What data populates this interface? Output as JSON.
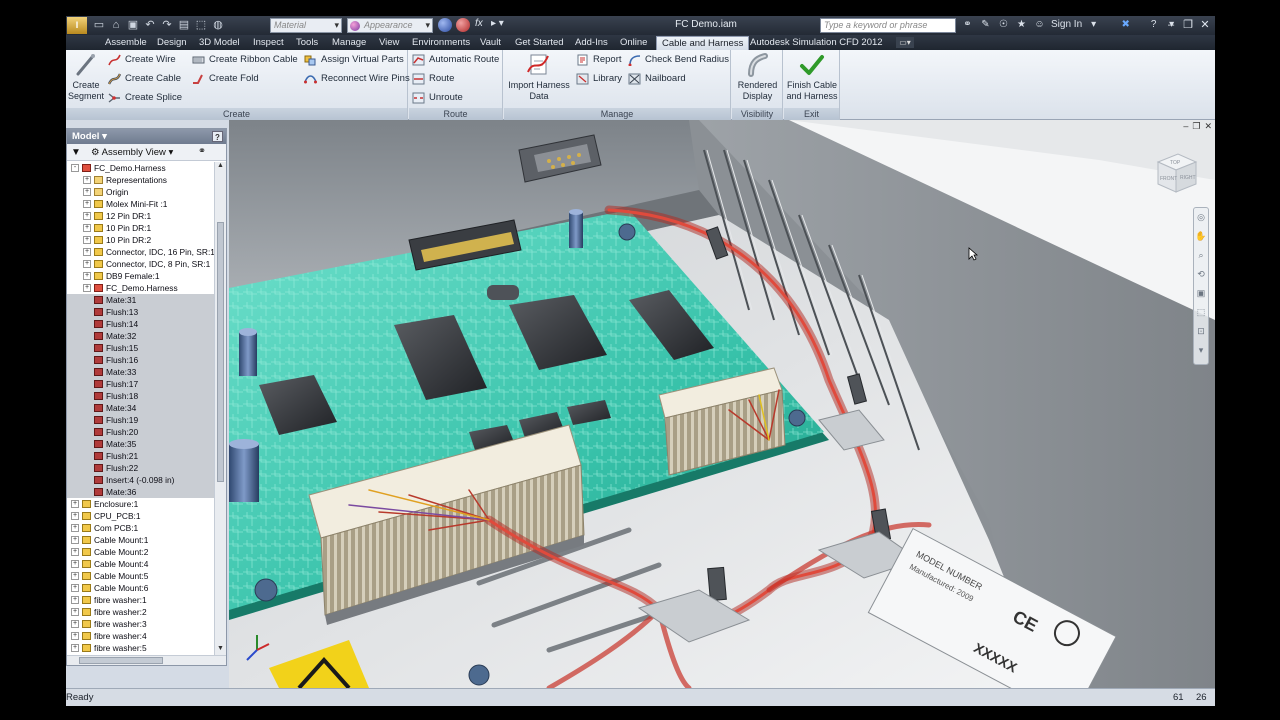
{
  "app": {
    "logo_text": "I",
    "document_title": "FC Demo.iam",
    "material_placeholder": "Material",
    "appearance_placeholder": "Appearance",
    "search_placeholder": "Type a keyword or phrase",
    "sign_in": "Sign In",
    "fx_label": "fx"
  },
  "tabs": [
    {
      "label": "Assemble"
    },
    {
      "label": "Design"
    },
    {
      "label": "3D Model"
    },
    {
      "label": "Inspect"
    },
    {
      "label": "Tools"
    },
    {
      "label": "Manage"
    },
    {
      "label": "View"
    },
    {
      "label": "Environments"
    },
    {
      "label": "Vault"
    },
    {
      "label": "Get Started"
    },
    {
      "label": "Add-Ins"
    },
    {
      "label": "Online"
    },
    {
      "label": "Cable and Harness",
      "active": true
    },
    {
      "label": "Autodesk Simulation CFD 2012"
    }
  ],
  "ribbon": {
    "create": {
      "label": "Create",
      "create_segment": "Create Segment",
      "create_wire": "Create Wire",
      "create_cable": "Create Cable",
      "create_splice": "Create Splice",
      "create_ribbon_cable": "Create Ribbon Cable",
      "create_fold": "Create Fold",
      "assign_virtual_parts": "Assign Virtual Parts",
      "reconnect_wire_pins": "Reconnect Wire Pins"
    },
    "route": {
      "label": "Route",
      "automatic_route": "Automatic Route",
      "route": "Route",
      "unroute": "Unroute"
    },
    "manage": {
      "label": "Manage",
      "import_harness_data": "Import Harness Data",
      "report": "Report",
      "library": "Library",
      "check_bend_radius": "Check Bend Radius",
      "nailboard": "Nailboard"
    },
    "visibility": {
      "label": "Visibility",
      "rendered_display": "Rendered Display"
    },
    "exit": {
      "label": "Exit",
      "finish": "Finish Cable and Harness"
    }
  },
  "browser": {
    "title": "Model",
    "help": "?",
    "view_label": "Assembly View",
    "tree": [
      {
        "label": "FC_Demo.Harness",
        "level": 0,
        "exp": "-",
        "icon": "harness",
        "grey": false
      },
      {
        "label": "Representations",
        "level": 1,
        "exp": "+",
        "icon": "folder",
        "grey": false
      },
      {
        "label": "Origin",
        "level": 1,
        "exp": "+",
        "icon": "folder",
        "grey": false
      },
      {
        "label": "Molex Mini-Fit :1",
        "level": 1,
        "exp": "+",
        "icon": "part",
        "grey": false
      },
      {
        "label": "12 Pin DR:1",
        "level": 1,
        "exp": "+",
        "icon": "part",
        "grey": false
      },
      {
        "label": "10 Pin DR:1",
        "level": 1,
        "exp": "+",
        "icon": "part",
        "grey": false
      },
      {
        "label": "10 Pin DR:2",
        "level": 1,
        "exp": "+",
        "icon": "part",
        "grey": false
      },
      {
        "label": "Connector, IDC, 16 Pin, SR:1",
        "level": 1,
        "exp": "+",
        "icon": "part",
        "grey": false
      },
      {
        "label": "Connector, IDC, 8 Pin, SR:1",
        "level": 1,
        "exp": "+",
        "icon": "part",
        "grey": false
      },
      {
        "label": "DB9 Female:1",
        "level": 1,
        "exp": "+",
        "icon": "part",
        "grey": false
      },
      {
        "label": "FC_Demo.Harness",
        "level": 1,
        "exp": "+",
        "icon": "harness",
        "grey": false
      },
      {
        "label": "Mate:31",
        "level": 1,
        "exp": "",
        "icon": "mate",
        "grey": true
      },
      {
        "label": "Flush:13",
        "level": 1,
        "exp": "",
        "icon": "mate",
        "grey": true
      },
      {
        "label": "Flush:14",
        "level": 1,
        "exp": "",
        "icon": "mate",
        "grey": true
      },
      {
        "label": "Mate:32",
        "level": 1,
        "exp": "",
        "icon": "mate",
        "grey": true
      },
      {
        "label": "Flush:15",
        "level": 1,
        "exp": "",
        "icon": "mate",
        "grey": true
      },
      {
        "label": "Flush:16",
        "level": 1,
        "exp": "",
        "icon": "mate",
        "grey": true
      },
      {
        "label": "Mate:33",
        "level": 1,
        "exp": "",
        "icon": "mate",
        "grey": true
      },
      {
        "label": "Flush:17",
        "level": 1,
        "exp": "",
        "icon": "mate",
        "grey": true
      },
      {
        "label": "Flush:18",
        "level": 1,
        "exp": "",
        "icon": "mate",
        "grey": true
      },
      {
        "label": "Mate:34",
        "level": 1,
        "exp": "",
        "icon": "mate",
        "grey": true
      },
      {
        "label": "Flush:19",
        "level": 1,
        "exp": "",
        "icon": "mate",
        "grey": true
      },
      {
        "label": "Flush:20",
        "level": 1,
        "exp": "",
        "icon": "mate",
        "grey": true
      },
      {
        "label": "Mate:35",
        "level": 1,
        "exp": "",
        "icon": "mate",
        "grey": true
      },
      {
        "label": "Flush:21",
        "level": 1,
        "exp": "",
        "icon": "mate",
        "grey": true
      },
      {
        "label": "Flush:22",
        "level": 1,
        "exp": "",
        "icon": "mate",
        "grey": true
      },
      {
        "label": "Insert:4 (-0.098 in)",
        "level": 1,
        "exp": "",
        "icon": "mate",
        "grey": true
      },
      {
        "label": "Mate:36",
        "level": 1,
        "exp": "",
        "icon": "mate",
        "grey": true
      },
      {
        "label": "Enclosure:1",
        "level": 0,
        "exp": "+",
        "icon": "part",
        "grey": false
      },
      {
        "label": "CPU_PCB:1",
        "level": 0,
        "exp": "+",
        "icon": "part",
        "grey": false
      },
      {
        "label": "Com PCB:1",
        "level": 0,
        "exp": "+",
        "icon": "part",
        "grey": false
      },
      {
        "label": "Cable Mount:1",
        "level": 0,
        "exp": "+",
        "icon": "part",
        "grey": false
      },
      {
        "label": "Cable Mount:2",
        "level": 0,
        "exp": "+",
        "icon": "part",
        "grey": false
      },
      {
        "label": "Cable Mount:4",
        "level": 0,
        "exp": "+",
        "icon": "part",
        "grey": false
      },
      {
        "label": "Cable Mount:5",
        "level": 0,
        "exp": "+",
        "icon": "part",
        "grey": false
      },
      {
        "label": "Cable Mount:6",
        "level": 0,
        "exp": "+",
        "icon": "part",
        "grey": false
      },
      {
        "label": "fibre washer:1",
        "level": 0,
        "exp": "+",
        "icon": "part",
        "grey": false
      },
      {
        "label": "fibre washer:2",
        "level": 0,
        "exp": "+",
        "icon": "part",
        "grey": false
      },
      {
        "label": "fibre washer:3",
        "level": 0,
        "exp": "+",
        "icon": "part",
        "grey": false
      },
      {
        "label": "fibre washer:4",
        "level": 0,
        "exp": "+",
        "icon": "part",
        "grey": false
      },
      {
        "label": "fibre washer:5",
        "level": 0,
        "exp": "+",
        "icon": "part",
        "grey": false
      }
    ]
  },
  "viewcube": {
    "face_top": "TOP",
    "face_front": "FRONT",
    "face_right": "RIGHT"
  },
  "label_plate": {
    "line1": "MODEL NUMBER",
    "line2": "Manufactured: 2009",
    "mark": "CE",
    "code": "XXXXX"
  },
  "status": {
    "text": "Ready",
    "n1": "61",
    "n2": "26"
  },
  "colors": {
    "active_tab": "#e1e8f1",
    "ribbon": "#e7ecf2",
    "pcb": "#3bc0a8",
    "harness": "#d8342c",
    "enclosure": "#c8ccd0"
  }
}
